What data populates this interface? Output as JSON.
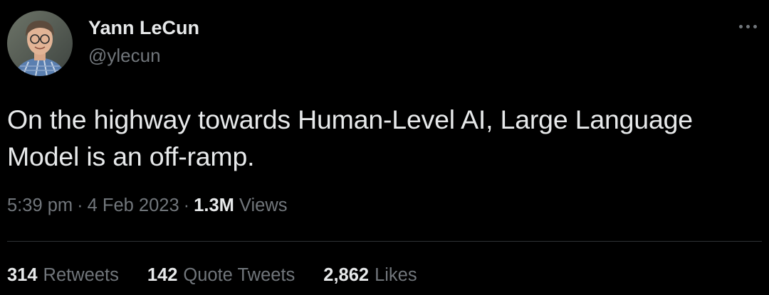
{
  "author": {
    "name": "Yann LeCun",
    "handle": "@ylecun"
  },
  "tweet": {
    "text": "On the highway towards Human-Level AI, Large Language Model is an off-ramp."
  },
  "meta": {
    "time": "5:39 pm",
    "date": "4 Feb 2023",
    "separator": "·",
    "views_count": "1.3M",
    "views_label": "Views"
  },
  "stats": {
    "retweets": {
      "count": "314",
      "label": "Retweets"
    },
    "quote_tweets": {
      "count": "142",
      "label": "Quote Tweets"
    },
    "likes": {
      "count": "2,862",
      "label": "Likes"
    }
  },
  "icons": {
    "more": "more-horizontal-icon"
  },
  "colors": {
    "background": "#000000",
    "primary_text": "#e7e9ea",
    "secondary_text": "#71767b",
    "divider": "#2f3336"
  }
}
